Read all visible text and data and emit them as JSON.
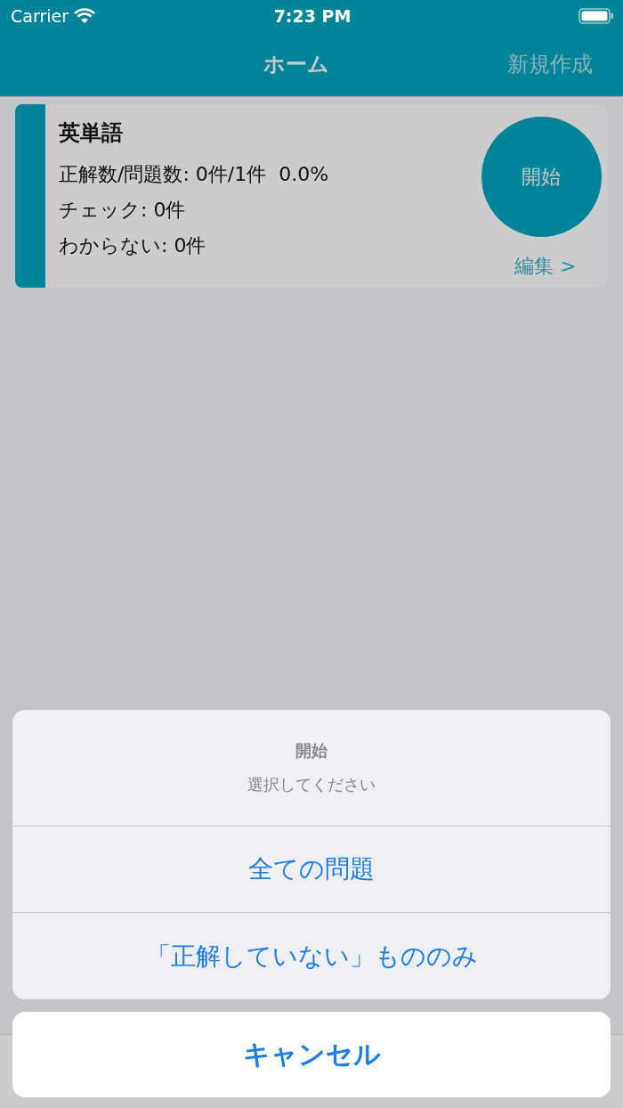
{
  "status_bar": {
    "carrier": "Carrier",
    "time": "7:23 PM"
  },
  "nav_bar": {
    "title": "ホーム",
    "right_button": "新規作成"
  },
  "card": {
    "title": "英単語",
    "stats": [
      "正解数/問題数: 0件/1件  0.0%",
      "チェック: 0件",
      "わからない: 0件"
    ],
    "start_button": "開始",
    "edit_link": "編集 >"
  },
  "action_sheet": {
    "title": "開始",
    "message": "選択してください",
    "actions": [
      "全ての問題",
      "「正解していない」もののみ"
    ],
    "cancel": "キャンセル"
  }
}
